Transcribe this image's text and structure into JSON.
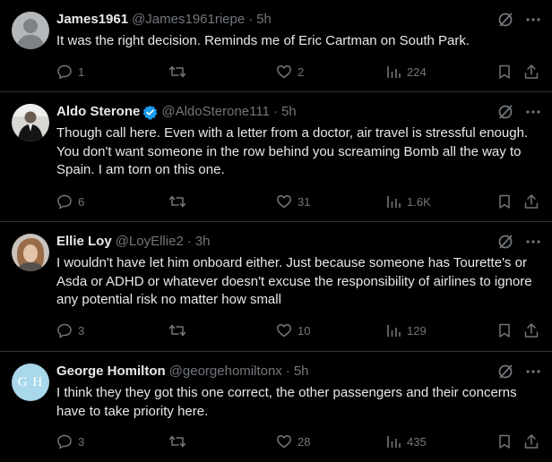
{
  "tweets": [
    {
      "name": "James1961",
      "handle": "@James1961riepe",
      "time": "5h",
      "text": "It was the right decision. Reminds me of Eric Cartman on South Park.",
      "reply_count": "1",
      "retweet_count": "",
      "like_count": "2",
      "view_count": "224",
      "verified": false
    },
    {
      "name": "Aldo Sterone",
      "handle": "@AldoSterone111",
      "time": "5h",
      "text": "Though call here. Even with a letter from a doctor, air travel is stressful enough. You don't want someone in the row behind you screaming Bomb all the way to Spain. I am torn on this one.",
      "reply_count": "6",
      "retweet_count": "",
      "like_count": "31",
      "view_count": "1.6K",
      "verified": true
    },
    {
      "name": "Ellie Loy",
      "handle": "@LoyEllie2",
      "time": "3h",
      "text": "I wouldn't have let him onboard either. Just because someone has Tourette's or Asda or ADHD or whatever doesn't excuse the responsibility of airlines to ignore any potential risk no matter how small",
      "reply_count": "3",
      "retweet_count": "",
      "like_count": "10",
      "view_count": "129",
      "verified": false
    },
    {
      "name": "George Homilton",
      "handle": "@georgehomiltonx",
      "time": "5h",
      "text": "I think they they got this one correct, the other passengers and their concerns have to take priority here.",
      "reply_count": "3",
      "retweet_count": "",
      "like_count": "28",
      "view_count": "435",
      "verified": false,
      "avatar_initials": "G H"
    }
  ],
  "separator": "·",
  "colors": {
    "background": "#000000",
    "text": "#e7e9ea",
    "muted": "#71767b",
    "divider": "#2f3336",
    "verified": "#1d9bf0",
    "gh_avatar": "#a8d8ea"
  },
  "icons": [
    "grok-icon",
    "more-icon",
    "reply-icon",
    "retweet-icon",
    "like-icon",
    "views-icon",
    "bookmark-icon",
    "share-icon"
  ]
}
